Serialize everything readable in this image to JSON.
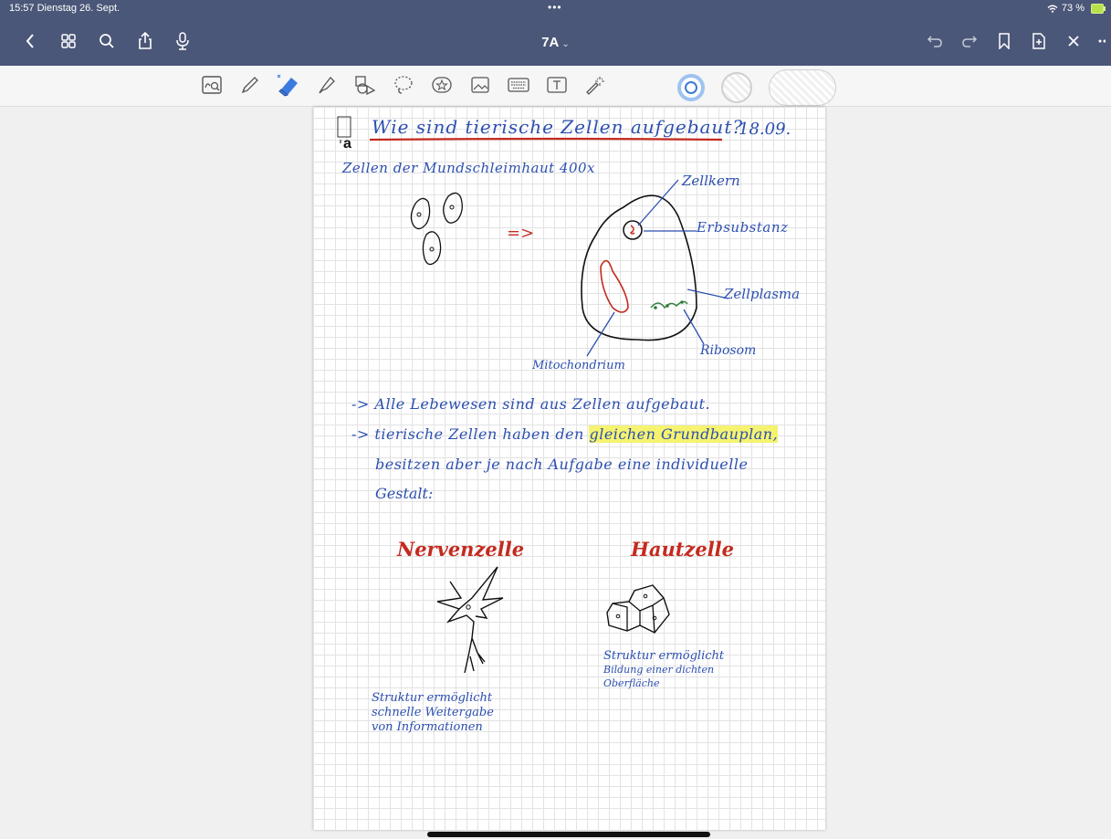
{
  "status_bar": {
    "time_date": "15:57  Dienstag 26. Sept.",
    "dots": "•••",
    "battery_percent": "73 %"
  },
  "nav": {
    "title": "7A",
    "title_caret": "⌄"
  },
  "toolbar": {
    "tools": [
      "zoom-window-icon",
      "pen-icon",
      "eraser-icon",
      "highlighter-icon",
      "shapes-icon",
      "lasso-icon",
      "sticker-icon",
      "image-icon",
      "keyboard-icon",
      "textbox-icon",
      "laser-pointer-icon"
    ],
    "selected_color": "#3d7ad8"
  },
  "note": {
    "margin_glyph": "a",
    "title": "Wie sind tierische Zellen aufgebaut?",
    "date": "18.09.",
    "subtitle": "Zellen der Mundschleimhaut 400x",
    "arrow": "=>",
    "labels": {
      "zellkern": "Zellkern",
      "erbsubstanz": "Erbsubstanz",
      "zellplasma": "Zellplasma",
      "ribosom": "Ribosom",
      "mitochondrium": "Mitochondrium"
    },
    "bullets": [
      "-> Alle Lebewesen sind aus Zellen aufgebaut.",
      "-> tierische Zellen haben den"
    ],
    "bullet2_highlight": "gleichen Grundbauplan,",
    "line3": "besitzen aber je nach Aufgabe eine individuelle",
    "line4": "Gestalt:",
    "nerve_title": "Nervenzelle",
    "skin_title": "Hautzelle",
    "nerve_text": [
      "Struktur ermöglicht",
      "schnelle Weitergabe",
      "von Informationen"
    ],
    "skin_text": [
      "Struktur ermöglicht",
      "Bildung einer dichten",
      "Oberfläche"
    ]
  },
  "colors": {
    "ink_blue": "#2c4fb0",
    "ink_red": "#c42b1f",
    "ink_green": "#2f7d3b",
    "highlight": "#f5f36f",
    "topbar": "#4b5778"
  }
}
